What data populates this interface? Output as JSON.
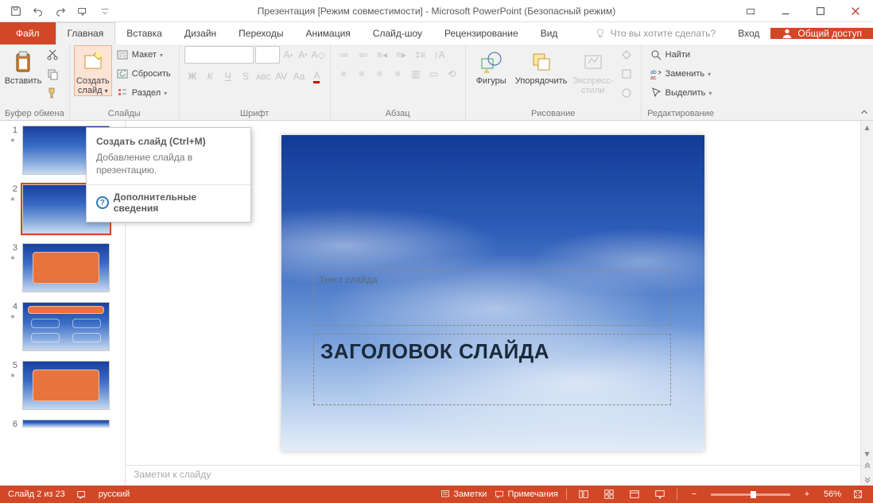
{
  "title": "Презентация [Режим совместимости] - Microsoft PowerPoint (Безопасный режим)",
  "tabs": {
    "file": "Файл",
    "home": "Главная",
    "insert": "Вставка",
    "design": "Дизайн",
    "transitions": "Переходы",
    "animations": "Анимация",
    "slideshow": "Слайд-шоу",
    "review": "Рецензирование",
    "view": "Вид"
  },
  "tell_me": "Что вы хотите сделать?",
  "sign_in": "Вход",
  "share": "Общий доступ",
  "groups": {
    "clipboard": {
      "label": "Буфер обмена",
      "paste": "Вставить"
    },
    "slides": {
      "label": "Слайды",
      "new_slide_top": "Создать",
      "new_slide_bottom": "слайд",
      "layout": "Макет",
      "reset": "Сбросить",
      "section": "Раздел"
    },
    "font": {
      "label": "Шрифт"
    },
    "paragraph": {
      "label": "Абзац"
    },
    "drawing": {
      "label": "Рисование",
      "shapes": "Фигуры",
      "arrange": "Упорядочить",
      "quick_top": "Экспресс-",
      "quick_bottom": "стили"
    },
    "editing": {
      "label": "Редактирование",
      "find": "Найти",
      "replace": "Заменить",
      "select": "Выделить"
    }
  },
  "tooltip": {
    "title": "Создать слайд (Ctrl+M)",
    "body": "Добавление слайда в презентацию.",
    "link": "Дополнительные сведения"
  },
  "thumbs": [
    "1",
    "2",
    "3",
    "4",
    "5",
    "6"
  ],
  "slide": {
    "content_placeholder": "Текст слайда",
    "title": "ЗАГОЛОВОК СЛАЙДА"
  },
  "notes_placeholder": "Заметки к слайду",
  "status": {
    "slide_no": "Слайд 2 из 23",
    "lang": "русский",
    "notes": "Заметки",
    "comments": "Примечания",
    "zoom": "56%"
  }
}
